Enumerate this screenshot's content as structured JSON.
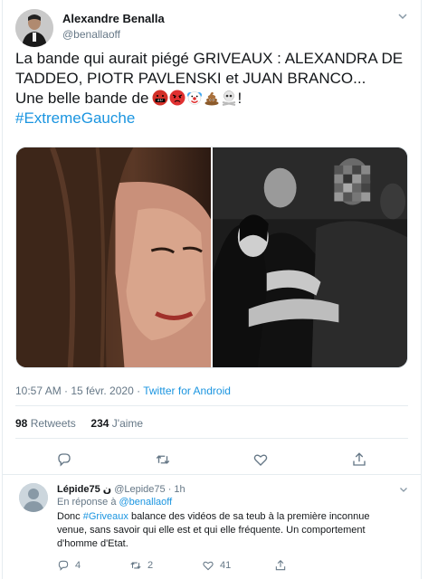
{
  "tweet": {
    "author_name": "Alexandre Benalla",
    "author_handle": "@benallaoff",
    "text_line1": "La bande qui aurait piégé GRIVEAUX : ALEXANDRA DE",
    "text_line2": "TADDEO, PIOTR PAVLENSKI et JUAN BRANCO...",
    "text_line3_prefix": "Une belle bande de",
    "text_line3_suffix": "!",
    "emojis": [
      "face-with-symbols-on-mouth",
      "pouting-face",
      "clown-face",
      "pile-of-poo",
      "skull-and-crossbones"
    ],
    "hashtag": "#ExtremeGauche",
    "timestamp": "10:57 AM · 15 févr. 2020 · ",
    "source": "Twitter for Android",
    "retweets_count": "98",
    "retweets_label": "Retweets",
    "likes_count": "234",
    "likes_label": "J'aime"
  },
  "reply": {
    "author_name": "Lépide75 ن",
    "author_handle": "@Lepide75 · 1h",
    "in_reply_prefix": "En réponse à ",
    "in_reply_mention": "@benallaoff",
    "text_prefix": "Donc ",
    "text_hashtag": "#Griveaux",
    "text_rest1": " balance des vidéos de sa teub à la première inconnue",
    "text_line2": "venue, sans savoir qui elle est et qui elle fréquente. Un comportement",
    "text_line3": "d'homme d'Etat.",
    "replies_count": "4",
    "retweets_count": "2",
    "likes_count": "41"
  },
  "colors": {
    "link": "#1b95e0",
    "secondary_text": "#657786",
    "primary_text": "#14171a",
    "border": "#e6ecf0"
  }
}
